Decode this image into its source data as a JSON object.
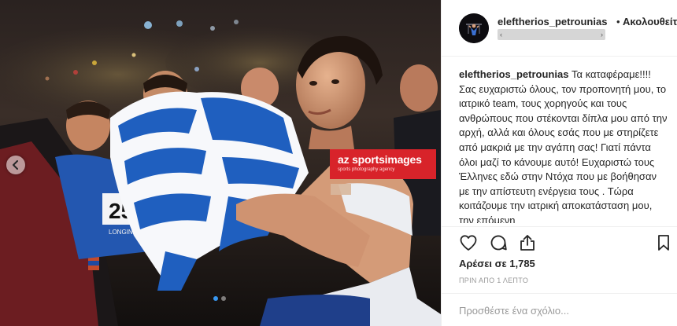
{
  "post": {
    "username": "eleftherios_petrounias",
    "separator": "•",
    "follow_label": "Ακολουθείτε",
    "caption_text": " Τα καταφέραμε!!!! Σας ευχαριστώ όλους, τον προπονητή μου, το ιατρικό team, τους χορηγούς και τους ανθρώπους που στέκονται δίπλα μου από την αρχή, αλλά και όλους εσάς που με στηρίζετε από μακριά με την αγάπη σας! Γιατί πάντα όλοι μαζί το κάνουμε αυτό! Ευχαριστώ τους Έλληνες εδώ στην Ντόχα που με βοήθησαν με την απίστευτη ενέργεια τους . Τώρα κοιτάζουμε την ιατρική αποκατάσταση μου, την επόμενη",
    "likes_text": "Αρέσει σε 1,785",
    "timestamp": "ΠΡΙΝ ΑΠΟ 1 ΛΕΠΤΟ",
    "comment_placeholder": "Προσθέστε ένα σχόλιο...",
    "carousel": {
      "total": 2,
      "active_index": 1
    }
  },
  "watermark": {
    "brand": "az sportsimages",
    "tagline": "sports photography agency"
  },
  "photo": {
    "bib_number": "25",
    "bib_sponsor": "LONGINES"
  },
  "icons": {
    "prev": "chevron-left-icon",
    "like": "heart-icon",
    "comment": "comment-bubble-icon",
    "share": "share-icon",
    "save": "bookmark-icon",
    "location_left": "‹",
    "location_right": "›"
  },
  "colors": {
    "accent": "#3897f0",
    "greek_blue": "#1f5fbf",
    "watermark_red": "#d8232a"
  }
}
